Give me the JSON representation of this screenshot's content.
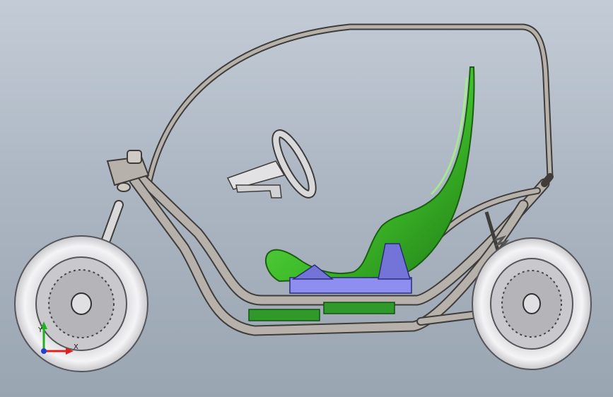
{
  "viewport": {
    "background_top": "#c3ccd6",
    "background_bottom": "#9aa5b2"
  },
  "model": {
    "frame_color": "#b7b1ab",
    "frame_edge_color": "#3f3c39",
    "seat_color": "#3fbe2a",
    "seat_mount_color": "#8e8ef0",
    "battery_color": "#2f9a2a",
    "tire_color": "#ececee",
    "rim_color": "#c9c9cd",
    "disc_color": "#b5b5b9"
  },
  "triad": {
    "x_label": "X",
    "y_label": "Y",
    "x_color": "#e02020",
    "y_color": "#20b020",
    "z_color": "#2040d0"
  }
}
